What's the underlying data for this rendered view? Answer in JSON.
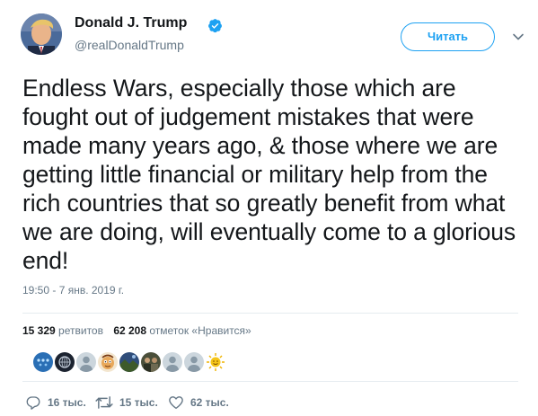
{
  "author": {
    "name": "Donald J. Trump",
    "handle": "@realDonaldTrump",
    "verified": true
  },
  "follow_button": {
    "label": "Читать"
  },
  "tweet": {
    "text": "Endless Wars, especially those which are fought out of judgement mistakes that were made many years ago, & those where we are getting little financial or military help from the rich countries that so greatly benefit from what we are doing, will eventually come to a glorious end!",
    "timestamp": "19:50 - 7 янв. 2019 г."
  },
  "stats": {
    "retweets_count": "15 329",
    "retweets_label": "ретвитов",
    "likes_count": "62 208",
    "likes_label": "отметок «Нравится»"
  },
  "liker_avatars": [
    {
      "icon": "blue-dots-avatar-icon",
      "color": "#2a6fb5"
    },
    {
      "icon": "dark-globe-avatar-icon",
      "color": "#1c2330"
    },
    {
      "icon": "default-person-avatar-icon",
      "color": "#ccd6dd"
    },
    {
      "icon": "cartoon-avatar-icon",
      "color": "#e8a85a"
    },
    {
      "icon": "landscape-avatar-icon",
      "color": "#3d5a2a"
    },
    {
      "icon": "group-photo-avatar-icon",
      "color": "#4a4f3a"
    },
    {
      "icon": "default-person-avatar-icon",
      "color": "#ccd6dd"
    },
    {
      "icon": "default-person-avatar-icon",
      "color": "#ccd6dd"
    },
    {
      "icon": "sun-avatar-icon",
      "color": "#f5c518"
    }
  ],
  "actions": {
    "replies": "16 тыс.",
    "retweets": "15 тыс.",
    "likes": "62 тыс."
  },
  "colors": {
    "accent": "#1da1f2",
    "text": "#14171a",
    "muted": "#657786",
    "divider": "#e6ecf0"
  }
}
